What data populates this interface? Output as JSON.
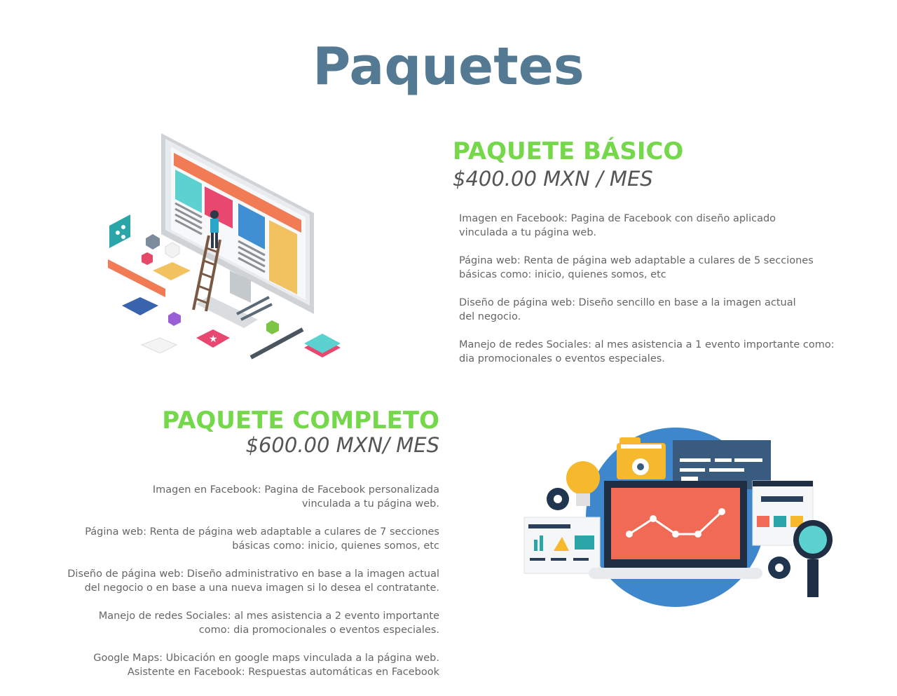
{
  "page": {
    "title": "Paquetes"
  },
  "packages": [
    {
      "title": "PAQUETE BÁSICO",
      "price": "$400.00 MXN / MES",
      "features": [
        "Imagen en Facebook: Pagina de Facebook con diseño aplicado\nvinculada a tu página web.",
        "Página web: Renta de página web adaptable a culares de 5 secciones\nbásicas como:  inicio, quienes somos, etc",
        "Diseño de página web: Diseño sencillo en base a la imagen actual\ndel negocio.",
        "Manejo de redes Sociales: al mes asistencia a 1 evento importante como:\ndia promocionales o eventos especiales."
      ]
    },
    {
      "title": "PAQUETE COMPLETO",
      "price": "$600.00 MXN/ MES",
      "features": [
        "Imagen en Facebook: Pagina de Facebook personalizada\nvinculada a tu página web.",
        "Página web: Renta de página web adaptable a culares de 7 secciones\nbásicas como:  inicio, quienes somos, etc",
        "Diseño de página web: Diseño administrativo en base a la imagen actual\ndel negocio o en base a una nueva imagen si lo desea el contratante.",
        "Manejo de redes Sociales: al mes asistencia a 2 evento importante\ncomo: dia promocionales o eventos especiales.",
        "Google Maps: Ubicación en google maps vinculada a la página web.\nAsistente en Facebook: Respuestas automáticas en Facebook"
      ]
    }
  ],
  "colors": {
    "title": "#547a93",
    "accent": "#74d84a",
    "text": "#666666"
  },
  "icons": [
    "web-design-illustration",
    "analytics-dashboard-illustration"
  ]
}
